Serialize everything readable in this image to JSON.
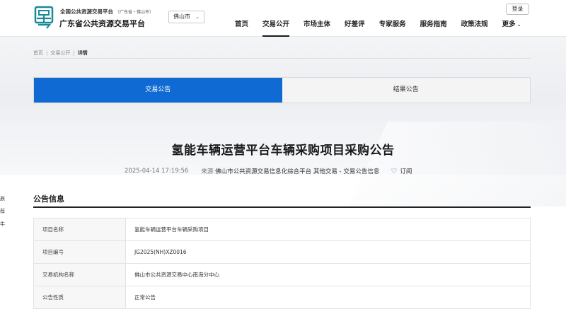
{
  "header": {
    "logo_icon": "guangdong-yue-logo",
    "platform_line1": "全国公共资源交易平台",
    "platform_line1_sub": "（广东省・佛山市）",
    "platform_line2": "广东省公共资源交易平台",
    "city_select": "佛山市",
    "login": "登录",
    "nav": [
      "首页",
      "交易公开",
      "市场主体",
      "好差评",
      "专家服务",
      "服务指南",
      "政策法规",
      "更多"
    ],
    "active_nav": "交易公开"
  },
  "breadcrumb": [
    "首页",
    "交易公开",
    "详情"
  ],
  "tabs": [
    {
      "label": "交易公告",
      "active": true
    },
    {
      "label": "结果公告",
      "active": false
    }
  ],
  "article": {
    "title": "氢能车辆运营平台车辆采购项目采购公告",
    "date": "2025-04-14 17:19:56",
    "source_label": "来源:",
    "source_value": "佛山市公共资源交易信息化综合平台 其他交易 - 交易公告信息",
    "subscribe": "订阅"
  },
  "side_fragments": [
    "辰",
    "荐",
    "牛"
  ],
  "section": {
    "title": "公告信息",
    "rows": [
      {
        "key": "项目名称",
        "value": "氢能车辆运营平台车辆采购项目"
      },
      {
        "key": "项目编号",
        "value": "JG2025(NH)XZ0016"
      },
      {
        "key": "交易机构名称",
        "value": "佛山市公共资源交易中心南海分中心"
      },
      {
        "key": "公告性质",
        "value": "正常公告"
      }
    ]
  },
  "colors": {
    "accent": "#0f6bd3",
    "logo_teal": "#1a8a9a"
  }
}
